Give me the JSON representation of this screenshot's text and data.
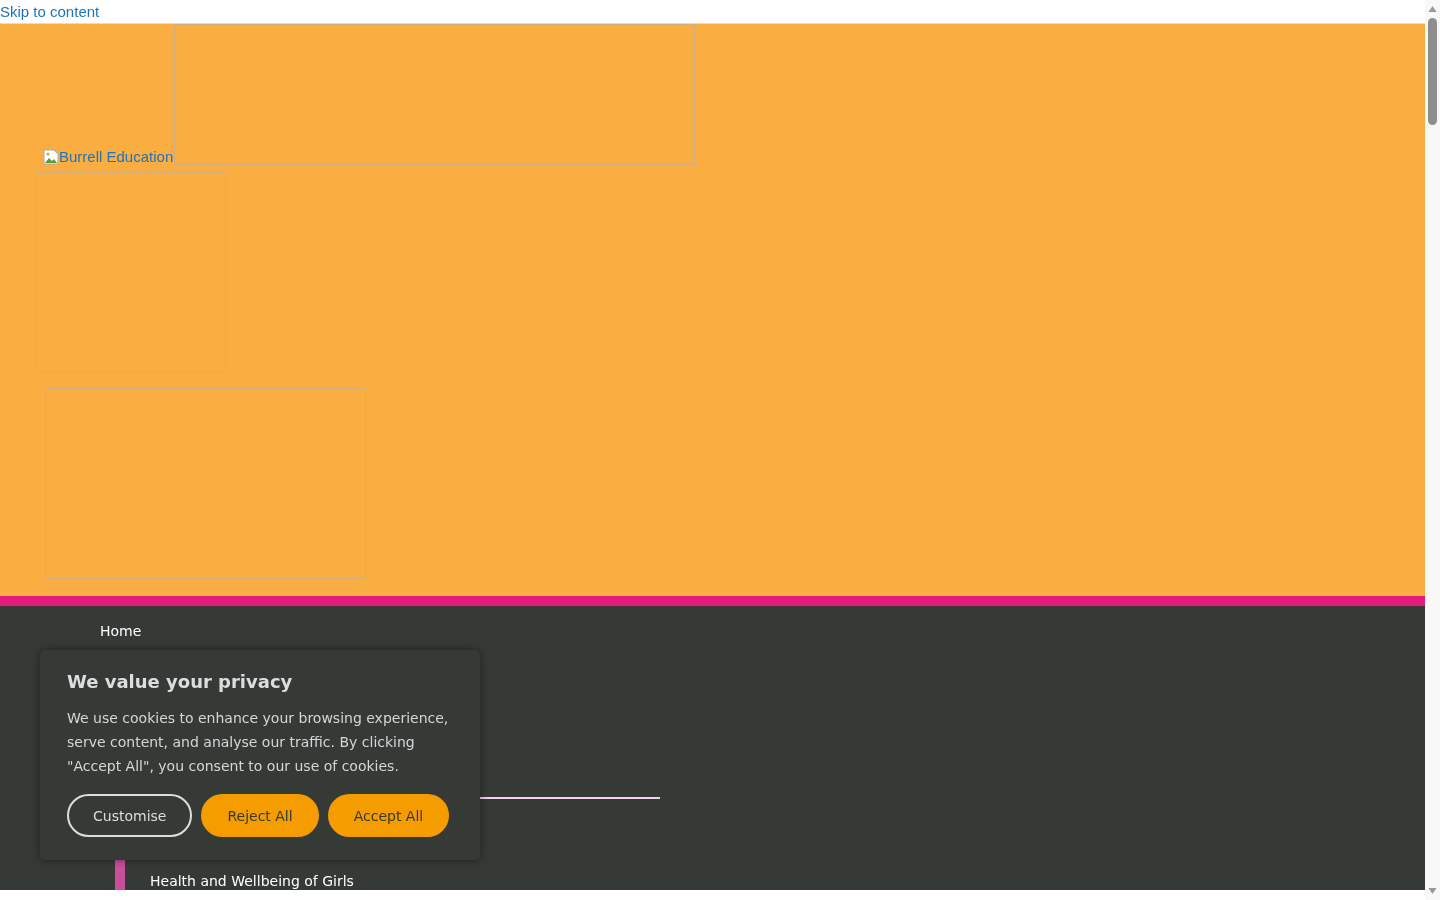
{
  "skip_link": "Skip to content",
  "header": {
    "logo_alt": "Burrell Education"
  },
  "nav": {
    "items": [
      {
        "label": "Home",
        "kind": "top"
      },
      {
        "label": "Health and Wellbeing of Girls",
        "kind": "sub"
      }
    ]
  },
  "cookie_banner": {
    "title": "We value your privacy",
    "text": "We use cookies to enhance your browsing experience, serve content, and analyse our traffic. By clicking \"Accept All\", you consent to our use of cookies.",
    "buttons": [
      {
        "label": "Customise",
        "kind": "outline"
      },
      {
        "label": "Reject All",
        "kind": "filled"
      },
      {
        "label": "Accept All",
        "kind": "filled"
      }
    ]
  }
}
